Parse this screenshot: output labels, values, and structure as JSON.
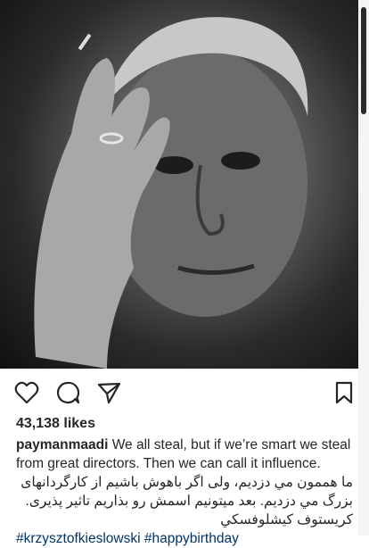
{
  "post": {
    "likes": "43,138 likes",
    "username": "paymanmaadi",
    "caption_en": " We all steal, but if we’re smart we steal from great directors. Then we can call it influence.",
    "caption_fa_1": "ما هممون مي دزديم، ولی اگر باهوش باشيم از کارگردانهای بزرگ مي دزديم. بعد ميتونيم اسمش رو بذاريم تاثير پذيری. کريستوف کيشلوفسکي",
    "hashtag_1": "#krzysztofkieslowski",
    "hashtag_2": "#happybirthday"
  },
  "icons": {
    "like": "heart-icon",
    "comment": "comment-icon",
    "share": "send-icon",
    "save": "bookmark-icon"
  }
}
